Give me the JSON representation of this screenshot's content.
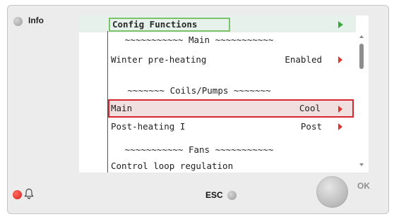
{
  "device": {
    "info_label": "Info",
    "esc_label": "ESC",
    "ok_label": "OK"
  },
  "screen": {
    "title": "Config Functions",
    "rows": [
      {
        "label": "~~~~~~~~~~~ Main ~~~~~~~~~~~",
        "value": "",
        "section": true
      },
      {
        "label": "Winter pre-heating",
        "value": "Enabled",
        "has_arrow": true
      },
      {
        "label": "",
        "value": "",
        "spacer": true
      },
      {
        "label": "~~~~~~~ Coils/Pumps ~~~~~~~",
        "value": "",
        "section": true
      },
      {
        "label": "Main",
        "value": "Cool",
        "has_arrow": true,
        "selected": true
      },
      {
        "label": "Post-heating I",
        "value": "Post",
        "has_arrow": true
      },
      {
        "label": "~~~~~~~~~~~ Fans ~~~~~~~~~~~",
        "value": "",
        "section": true
      },
      {
        "label": "Control loop regulation",
        "value": "",
        "partial": true
      }
    ]
  },
  "colors": {
    "title_border": "#7cc36b",
    "title_arrow": "#3aa83a",
    "selected_border": "#d9252d",
    "selected_fill": "#f1dede",
    "row_arrow": "#e0342d",
    "alarm_led": "#e5332a"
  },
  "icons": {
    "info_led": "led-grey",
    "alarm_led": "led-red",
    "bell": "bell-icon",
    "esc_led": "led-grey",
    "ok": "round-button"
  }
}
